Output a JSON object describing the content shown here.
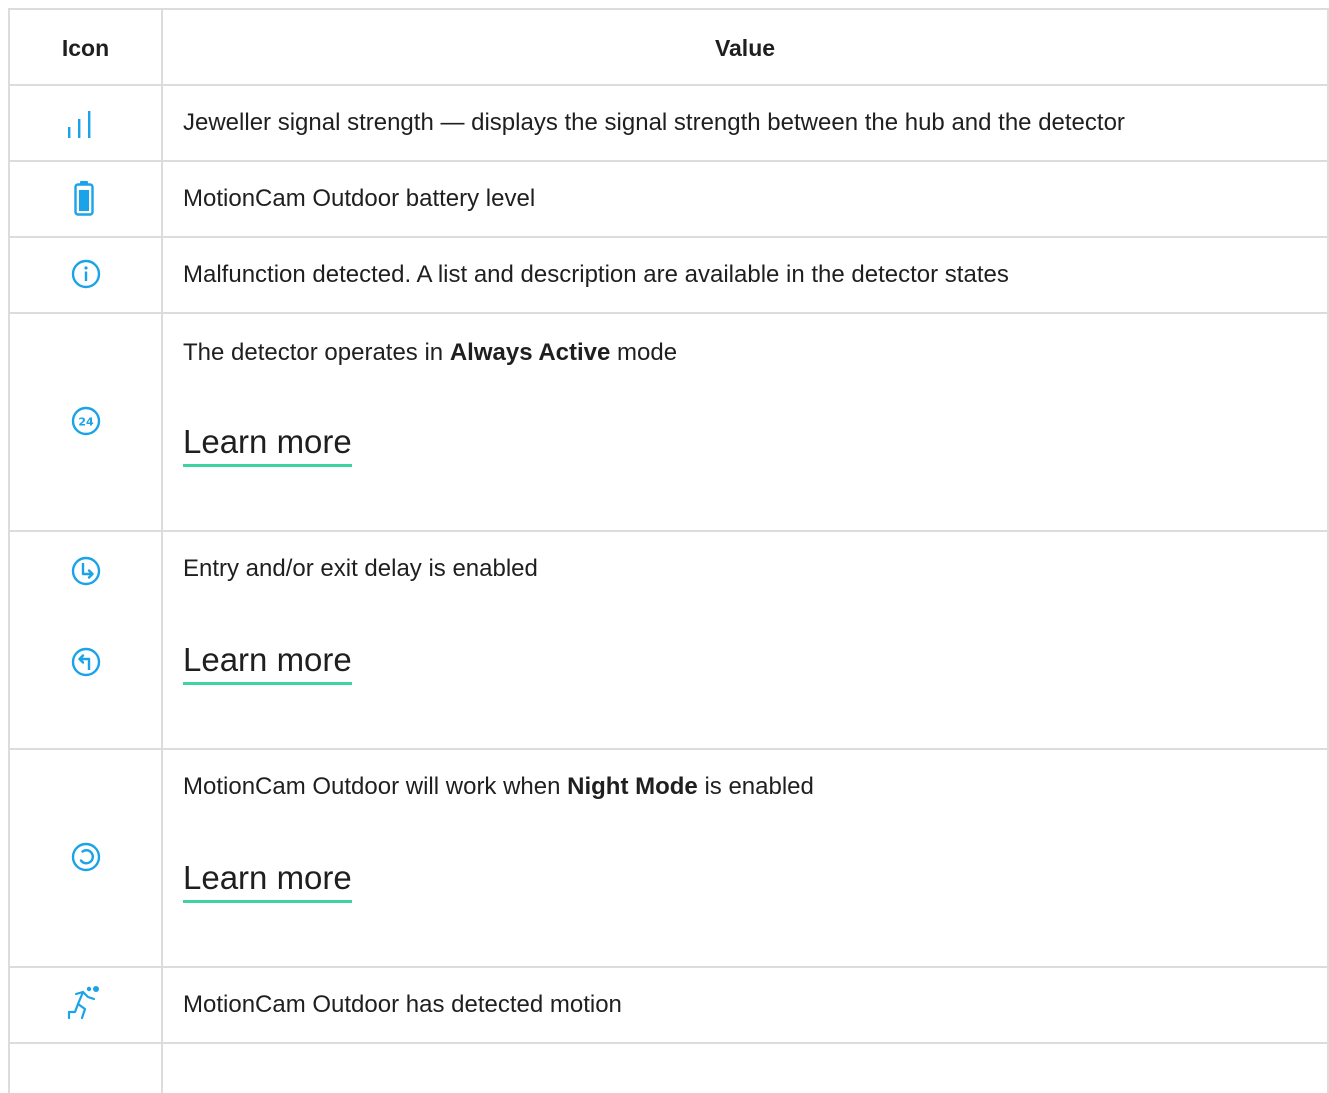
{
  "table": {
    "header": {
      "icon": "Icon",
      "value": "Value"
    },
    "rows": [
      {
        "icon": "signal-strength-icon",
        "text": "Jeweller signal strength — displays the signal strength between the hub and the detector"
      },
      {
        "icon": "battery-icon",
        "text": "MotionCam Outdoor battery level"
      },
      {
        "icon": "info-icon",
        "text": "Malfunction detected. A list and description are available in the detector states"
      },
      {
        "icon": "always-active-24-icon",
        "text_before": "The detector operates in ",
        "text_bold": "Always Active",
        "text_after": " mode",
        "link": "Learn more"
      },
      {
        "icon": "entry-delay-icon",
        "icon2": "exit-delay-icon",
        "text": "Entry and/or exit delay is enabled",
        "link": "Learn more"
      },
      {
        "icon": "night-mode-icon",
        "text_before": "MotionCam Outdoor will work when ",
        "text_bold": "Night Mode",
        "text_after": " is enabled",
        "link": "Learn more"
      },
      {
        "icon": "motion-detected-icon",
        "text": "MotionCam Outdoor has detected motion"
      }
    ]
  },
  "colors": {
    "icon": "#1aa3e8",
    "link_underline": "#3ed3a0",
    "border": "#dcdcdc"
  }
}
